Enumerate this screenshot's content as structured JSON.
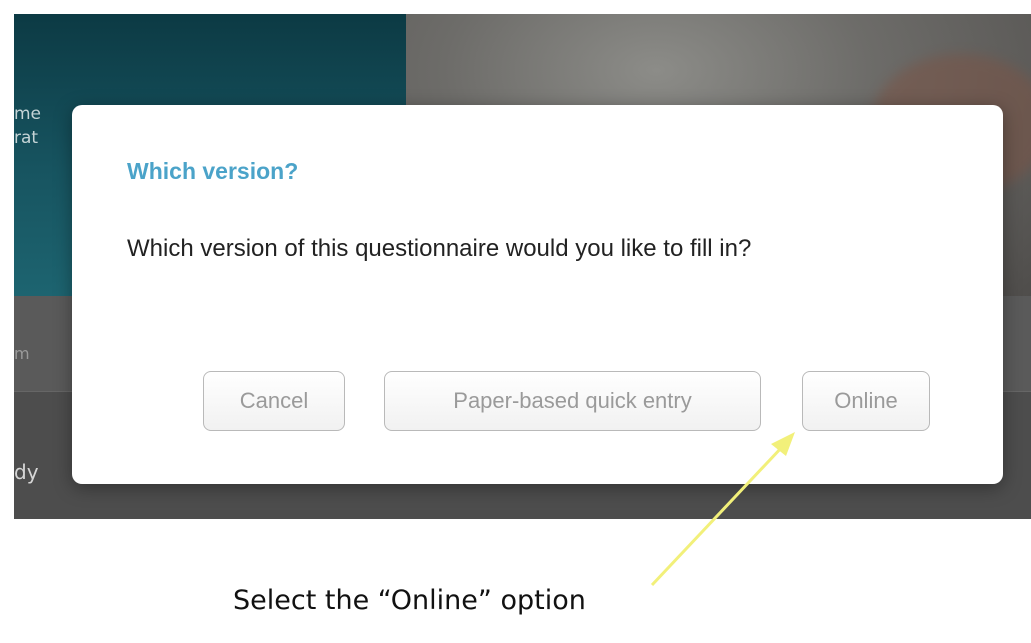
{
  "background": {
    "hero_text_1": "me",
    "hero_text_2": "rat",
    "band_text": "m",
    "row_text": "dy"
  },
  "dialog": {
    "title": "Which version?",
    "message": "Which version of this questionnaire would you like to fill in?",
    "buttons": {
      "cancel": "Cancel",
      "paper": "Paper-based quick entry",
      "online": "Online"
    }
  },
  "annotation": {
    "caption": "Select the “Online” option",
    "arrow_color": "#f2f07a"
  },
  "colors": {
    "title": "#4ba3c9",
    "button_text": "#9a9a9a"
  }
}
